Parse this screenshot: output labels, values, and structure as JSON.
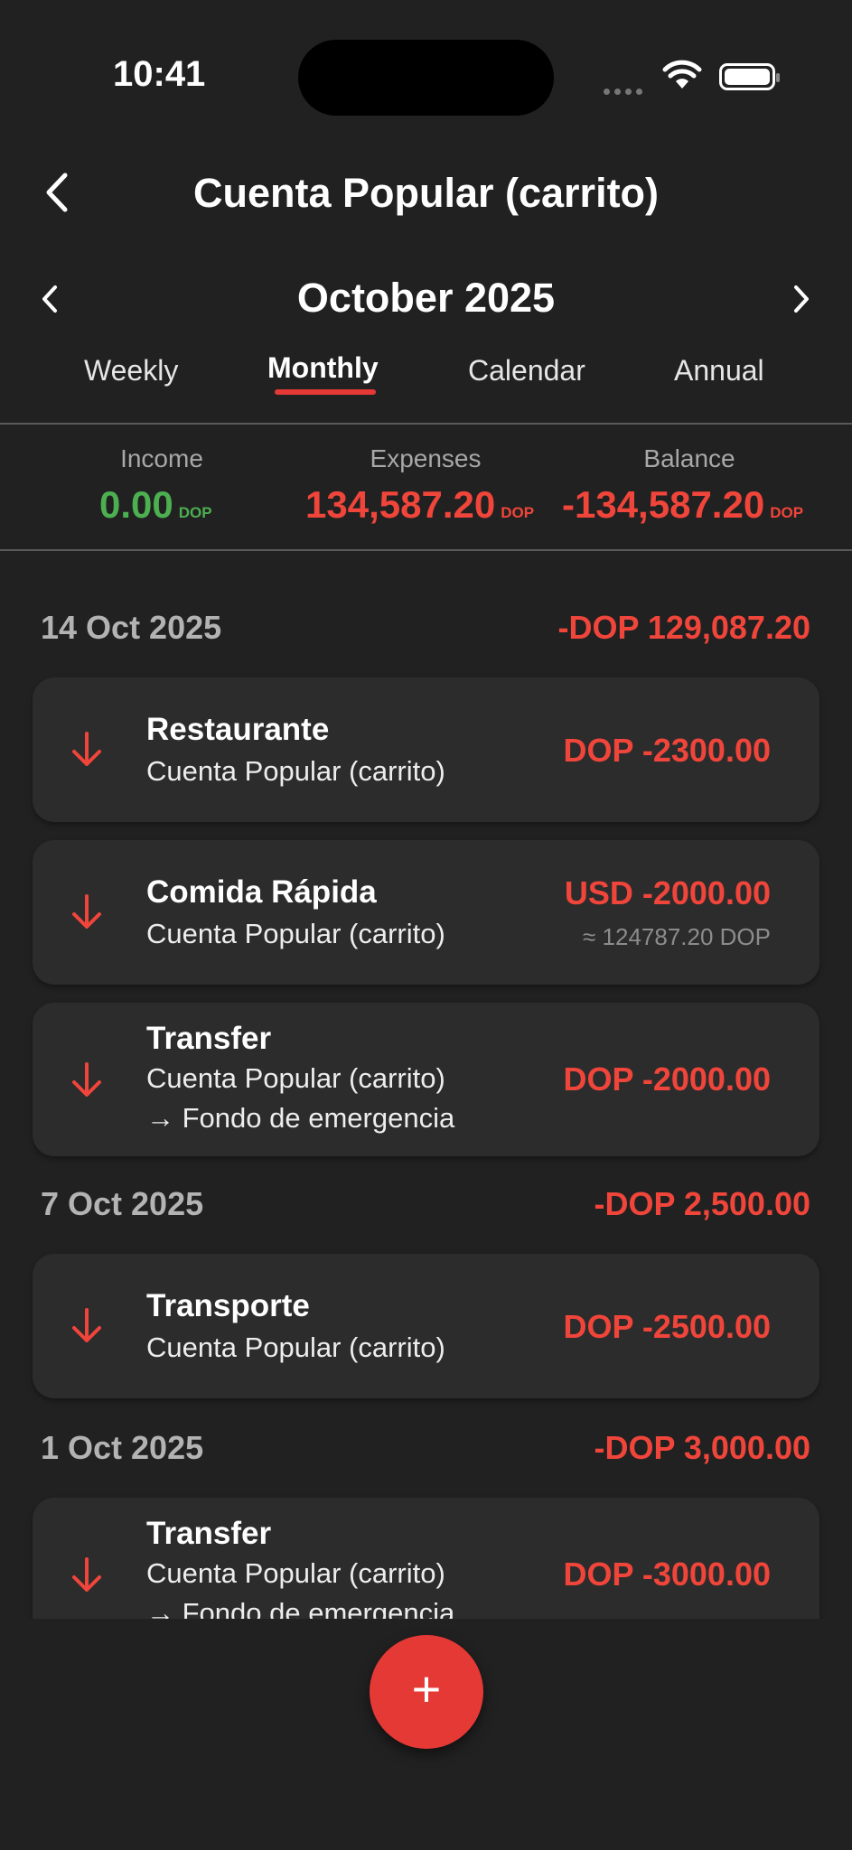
{
  "status_bar": {
    "time": "10:41"
  },
  "header": {
    "title": "Cuenta Popular (carrito)",
    "month": "October 2025"
  },
  "tabs": [
    {
      "label": "Weekly"
    },
    {
      "label": "Monthly"
    },
    {
      "label": "Calendar"
    },
    {
      "label": "Annual"
    }
  ],
  "summary": {
    "income": {
      "label": "Income",
      "value": "0.00",
      "currency": "DOP"
    },
    "expenses": {
      "label": "Expenses",
      "value": "134,587.20",
      "currency": "DOP"
    },
    "balance": {
      "label": "Balance",
      "value": "-134,587.20",
      "currency": "DOP"
    }
  },
  "groups": [
    {
      "date": "14 Oct 2025",
      "total": "-DOP 129,087.20",
      "transactions": [
        {
          "category": "Restaurante",
          "account": "Cuenta Popular (carrito)",
          "amount": "DOP -2300.00"
        },
        {
          "category": "Comida Rápida",
          "account": "Cuenta Popular (carrito)",
          "amount": "USD -2000.00",
          "converted": "≈ 124787.20 DOP"
        },
        {
          "category": "Transfer",
          "account": "Cuenta Popular (carrito)",
          "destination": "→ Fondo de emergencia",
          "amount": "DOP -2000.00"
        }
      ]
    },
    {
      "date": "7 Oct 2025",
      "total": "-DOP 2,500.00",
      "transactions": [
        {
          "category": "Transporte",
          "account": "Cuenta Popular (carrito)",
          "amount": "DOP -2500.00"
        }
      ]
    },
    {
      "date": "1 Oct 2025",
      "total": "-DOP 3,000.00",
      "transactions": [
        {
          "category": "Transfer",
          "account": "Cuenta Popular (carrito)",
          "destination": "→ Fondo de emergencia",
          "amount": "DOP -3000.00"
        }
      ]
    }
  ],
  "fab": {
    "label": "+"
  },
  "colors": {
    "background": "#212121",
    "card": "#2c2c2c",
    "accent_red": "#e53935",
    "income_green": "#4caf50"
  },
  "icons": [
    "back-chevron-icon",
    "chevron-left-icon",
    "chevron-right-icon",
    "arrow-down-icon",
    "plus-icon",
    "wifi-icon",
    "battery-icon"
  ]
}
